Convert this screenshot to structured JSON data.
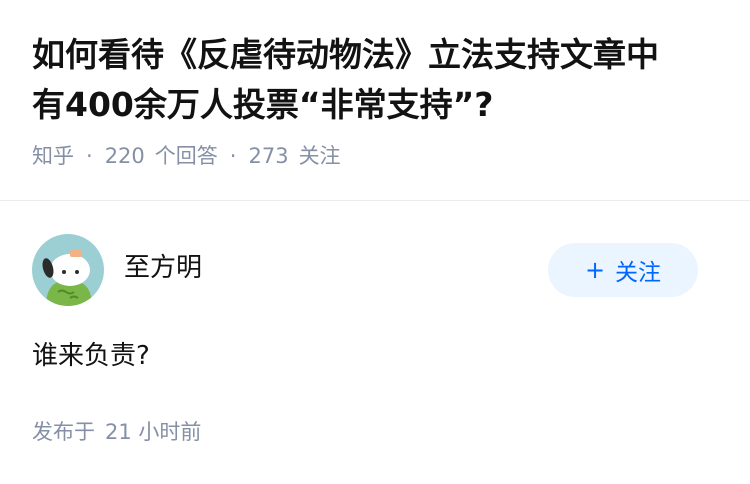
{
  "question": {
    "title_line1": "如何看待《反虐待动物法》立法支持文章中",
    "title_line2": "有400余万人投票“非常支持”?",
    "source": "知乎",
    "answer_count": "220",
    "answer_label": "个回答",
    "follower_count": "273",
    "follower_label": "关注"
  },
  "answer": {
    "author_name": "至方明",
    "follow_label": "关注",
    "content": "谁来负责?",
    "published_label": "发布于",
    "published_time": "21 小时前"
  },
  "colors": {
    "meta_text": "#8590a6",
    "follow_bg": "#ebf5ff",
    "follow_text": "#0066ff",
    "avatar_bg": "#9bcfd4",
    "avatar_green": "#7ab648"
  },
  "icons": {
    "follow": "plus-icon"
  }
}
